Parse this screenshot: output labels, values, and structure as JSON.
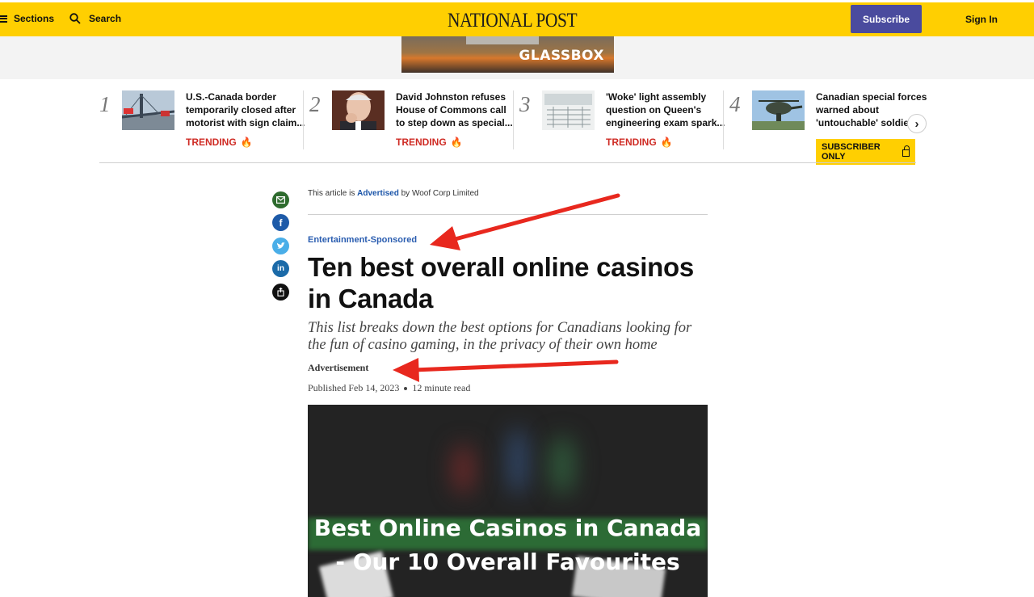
{
  "header": {
    "sections_label": "Sections",
    "search_label": "Search",
    "logo_text": "NATIONAL POST",
    "subscribe_label": "Subscribe",
    "signin_label": "Sign In"
  },
  "ad_banner": {
    "brand": "GLASSBOX"
  },
  "trending": [
    {
      "num": "1",
      "title": "U.S.-Canada border temporarily closed after motorist with sign claim...",
      "tag": "TRENDING"
    },
    {
      "num": "2",
      "title": "David Johnston refuses House of Commons call to step down as special...",
      "tag": "TRENDING"
    },
    {
      "num": "3",
      "title": "'Woke' light assembly question on Queen's engineering exam spark...",
      "tag": "TRENDING"
    },
    {
      "num": "4",
      "title": "Canadian special forces warned about 'untouchable' soldiers...",
      "tag": "SUBSCRIBER ONLY"
    }
  ],
  "article": {
    "adv_prefix": "This article is",
    "adv_link": "Advertised",
    "adv_suffix": "by Woof Corp Limited",
    "category": "Entertainment-Sponsored",
    "headline": "Ten best overall online casinos in Canada",
    "deck": "This list breaks down the best options for Canadians looking for the fun of casino gaming, in the privacy of their own home",
    "advert_label": "Advertisement",
    "published": "Published Feb 14, 2023",
    "read_time": "12 minute read",
    "hero_text": "Best Online Casinos in Canada - Our 10 Overall Favourites"
  },
  "share": [
    "email-icon",
    "facebook-icon",
    "twitter-icon",
    "linkedin-icon",
    "share-icon"
  ],
  "colors": {
    "header_bg": "#ffcf01",
    "subscribe_bg": "#4a4b9e",
    "trending_red": "#cf2b24",
    "category_blue": "#2a5db0",
    "annotation_red": "#e8281e"
  }
}
